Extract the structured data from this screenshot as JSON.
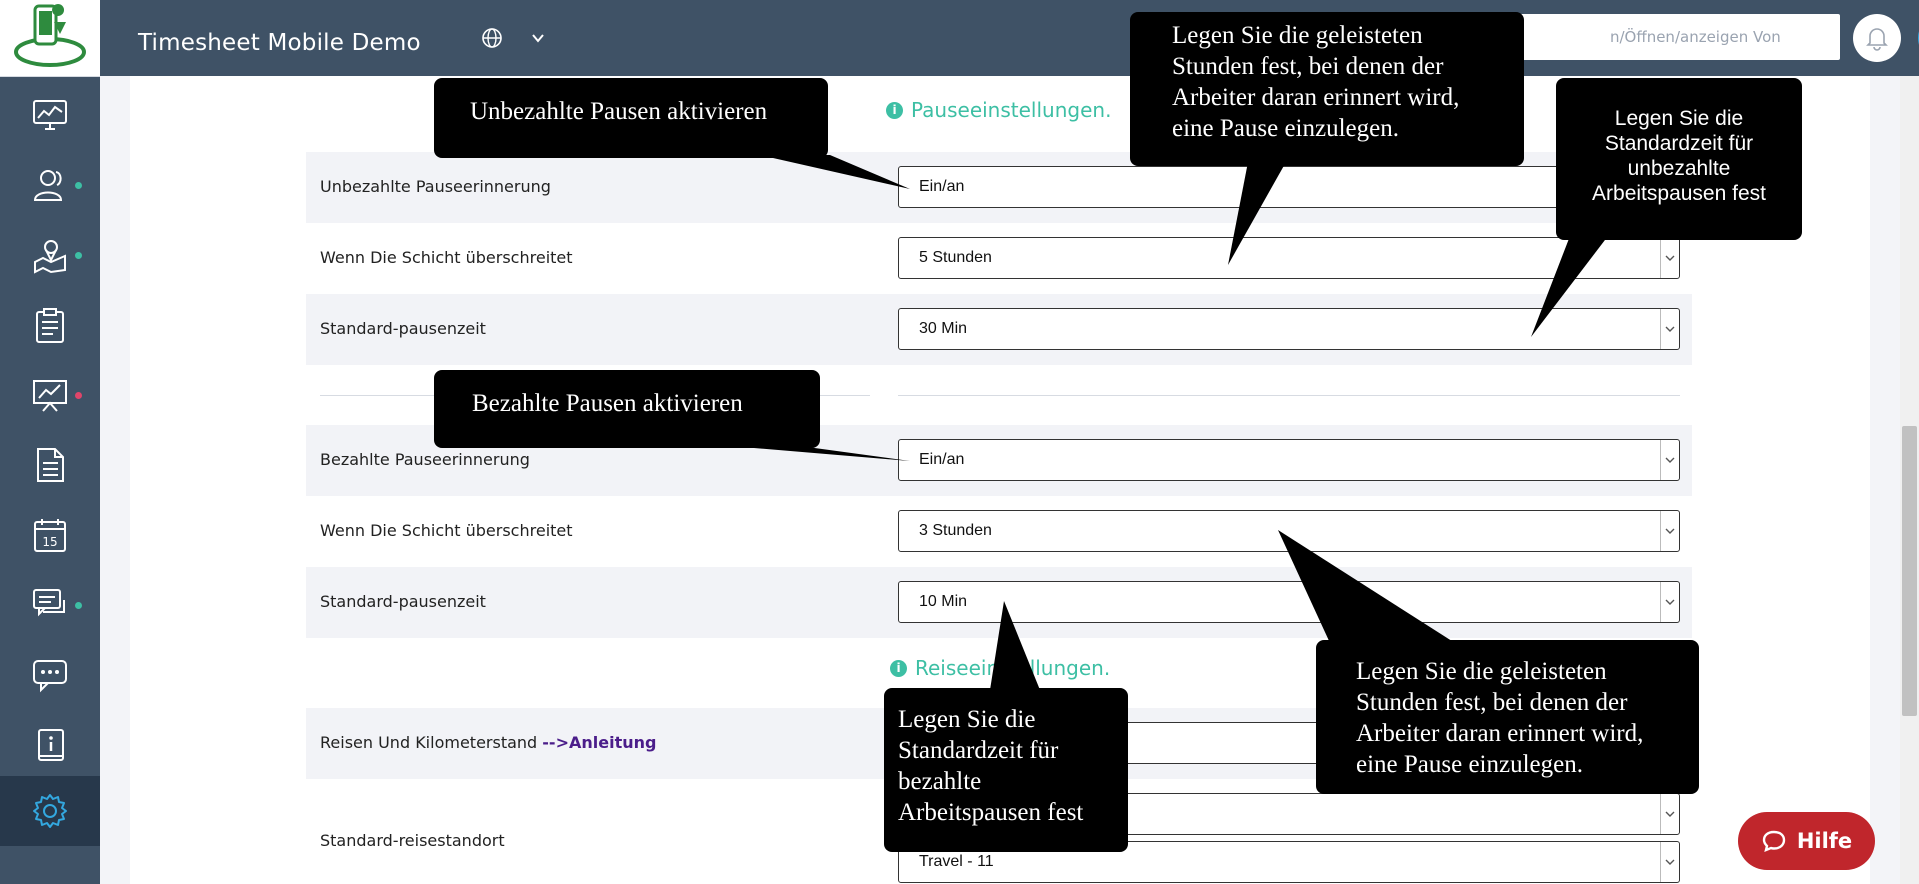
{
  "app": {
    "title": "Timesheet Mobile Demo"
  },
  "search": {
    "placeholder": "n/Öffnen/anzeigen Von"
  },
  "sidebar": {
    "items": [
      {
        "icon": "dashboard-monitor-icon",
        "dot": ""
      },
      {
        "icon": "users-icon",
        "dot": "#3dbfa4"
      },
      {
        "icon": "location-map-icon",
        "dot": "#3dbfa4"
      },
      {
        "icon": "clipboard-list-icon",
        "dot": ""
      },
      {
        "icon": "reports-chart-icon",
        "dot": "#e0456a"
      },
      {
        "icon": "document-icon",
        "dot": ""
      },
      {
        "icon": "calendar-icon",
        "dot": ""
      },
      {
        "icon": "chat-icon",
        "dot": "#3dbfa4"
      },
      {
        "icon": "message-bubble-icon",
        "dot": ""
      },
      {
        "icon": "info-book-icon",
        "dot": ""
      },
      {
        "icon": "settings-gear-icon",
        "dot": ""
      }
    ],
    "calendar_day": "15"
  },
  "sections": {
    "breaks": "Pauseeinstellungen.",
    "travel": "Reiseeinstellungen."
  },
  "rows": {
    "unpaid_reminder": {
      "label": "Unbezahlte Pauseerinnerung",
      "value": "Ein/an"
    },
    "unpaid_exceeds": {
      "label": "Wenn Die Schicht überschreitet",
      "value": "5 Stunden"
    },
    "unpaid_default": {
      "label": "Standard-pausenzeit",
      "value": "30 Min"
    },
    "paid_reminder": {
      "label": "Bezahlte Pauseerinnerung",
      "value": "Ein/an"
    },
    "paid_exceeds": {
      "label": "Wenn Die Schicht überschreitet",
      "value": "3 Stunden"
    },
    "paid_default": {
      "label": "Standard-pausenzeit",
      "value": "10 Min"
    },
    "travel_mileage": {
      "label": "Reisen Und Kilometerstand ",
      "link": "-->Anleitung"
    },
    "travel_default": {
      "label": "Standard-reisestandort",
      "value": "Travel - 11"
    }
  },
  "callouts": {
    "enable_unpaid": "Unbezahlte Pausen aktivieren",
    "enable_paid": "Bezahlte Pausen aktivieren",
    "hours_unpaid": "Legen Sie die geleisteten Stunden fest, bei denen der Arbeiter daran erinnert wird, eine Pause einzulegen.",
    "default_unpaid": "Legen Sie die Standardzeit für unbezahlte Arbeitspausen fest",
    "default_paid": "Legen Sie die Standardzeit für bezahlte Arbeitspausen fest",
    "hours_paid": "Legen Sie die geleisteten Stunden fest, bei denen der Arbeiter daran erinnert wird, eine Pause einzulegen."
  },
  "help": {
    "label": "Hilfe"
  },
  "colors": {
    "sidebar": "#3f5266",
    "accent": "#3dbfa4",
    "help": "#c0262c",
    "user": "#33a8e0"
  }
}
